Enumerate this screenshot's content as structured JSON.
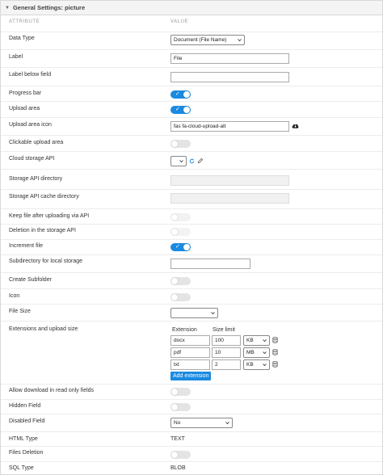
{
  "panel": {
    "title": "General Settings: picture",
    "columns": {
      "attribute": "ATTRIBUTE",
      "value": "VALUE"
    }
  },
  "fields": {
    "data_type": {
      "label": "Data Type",
      "value": "Document (File Name)"
    },
    "label": {
      "label": "Label",
      "value": "File"
    },
    "label_below": {
      "label": "Label below field",
      "value": ""
    },
    "progress_bar": {
      "label": "Progress bar",
      "on": true
    },
    "upload_area": {
      "label": "Upload area",
      "on": true
    },
    "upload_area_icon": {
      "label": "Upload area icon",
      "value": "fas fa-cloud-upload-alt"
    },
    "clickable_upload_area": {
      "label": "Clickable upload area",
      "on": false
    },
    "cloud_storage_api": {
      "label": "Cloud storage API",
      "value": ""
    },
    "storage_api_directory": {
      "label": "Storage API directory",
      "value": ""
    },
    "storage_api_cache_directory": {
      "label": "Storage API cache directory",
      "value": ""
    },
    "keep_file": {
      "label": "Keep file after uploading via API",
      "on": false
    },
    "deletion_storage_api": {
      "label": "Deletion in the storage API",
      "on": false
    },
    "increment_file": {
      "label": "Increment file",
      "on": true
    },
    "subdirectory_local": {
      "label": "Subdirectory for local storage",
      "value": ""
    },
    "create_subfolder": {
      "label": "Create Subfolder",
      "on": false
    },
    "icon": {
      "label": "Icon",
      "on": false
    },
    "file_size": {
      "label": "File Size",
      "value": ""
    },
    "extensions": {
      "label": "Extensions and upload size",
      "col_extension": "Extension",
      "col_size_limit": "Size limit",
      "rows": [
        {
          "extension": "docx",
          "size": "100",
          "unit": "KB"
        },
        {
          "extension": "pdf",
          "size": "10",
          "unit": "MB"
        },
        {
          "extension": "txt",
          "size": "2",
          "unit": "KB"
        }
      ],
      "add_label": "Add extension"
    },
    "allow_download": {
      "label": "Allow download in read only fields",
      "on": false
    },
    "hidden_field": {
      "label": "Hidden Field",
      "on": false
    },
    "disabled_field": {
      "label": "Disabled Field",
      "value": "No"
    },
    "html_type": {
      "label": "HTML Type",
      "value": "TEXT"
    },
    "files_deletion": {
      "label": "Files Deletion",
      "on": false
    },
    "sql_type": {
      "label": "SQL Type",
      "value": "BLOB"
    }
  },
  "colors": {
    "accent": "#1b8ae0",
    "toggle_off": "#e4e4e4",
    "border": "#d8d8d8"
  },
  "icons": {
    "upload_icon_preview": "cloud-upload-icon",
    "refresh": "refresh-icon",
    "edit": "pencil-icon",
    "delete": "trash-icon"
  }
}
